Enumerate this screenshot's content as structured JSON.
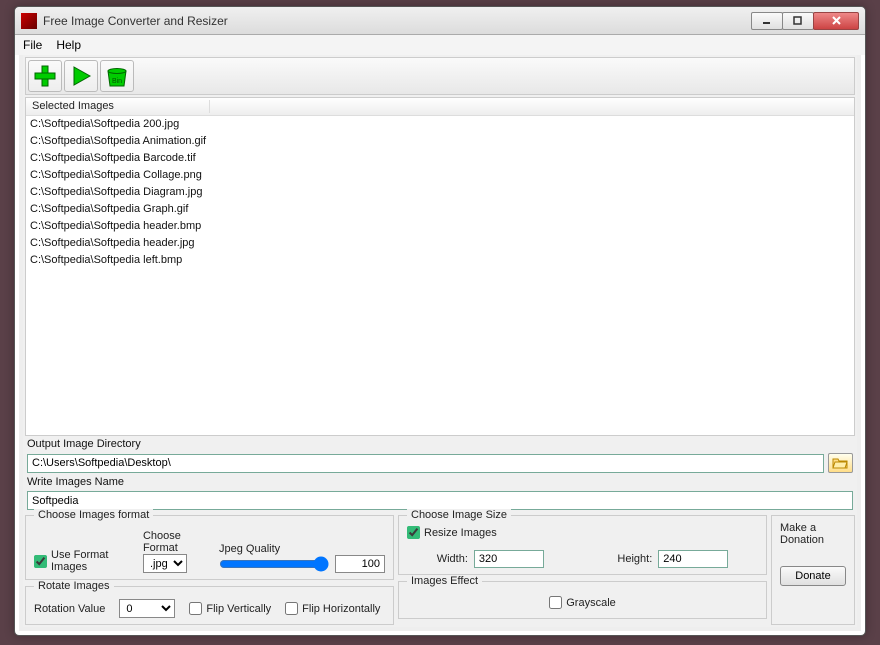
{
  "window": {
    "title": "Free Image Converter and Resizer"
  },
  "menu": {
    "file": "File",
    "help": "Help"
  },
  "toolbar": {
    "add": "add-button",
    "run": "run-button",
    "bin": "bin-button",
    "bin_label": "Bin"
  },
  "list": {
    "header": "Selected Images",
    "rows": [
      "C:\\Softpedia\\Softpedia 200.jpg",
      "C:\\Softpedia\\Softpedia Animation.gif",
      "C:\\Softpedia\\Softpedia Barcode.tif",
      "C:\\Softpedia\\Softpedia Collage.png",
      "C:\\Softpedia\\Softpedia Diagram.jpg",
      "C:\\Softpedia\\Softpedia Graph.gif",
      "C:\\Softpedia\\Softpedia header.bmp",
      "C:\\Softpedia\\Softpedia header.jpg",
      "C:\\Softpedia\\Softpedia left.bmp"
    ]
  },
  "output": {
    "dir_label": "Output Image Directory",
    "dir_value": "C:\\Users\\Softpedia\\Desktop\\",
    "name_label": "Write Images Name",
    "name_value": "Softpedia"
  },
  "format": {
    "group_title": "Choose Images format",
    "use_format_label": "Use Format Images",
    "choose_format_label": "Choose Format",
    "format_value": ".jpg",
    "quality_label": "Jpeg Quality",
    "quality_value": "100"
  },
  "rotate": {
    "group_title": "Rotate Images",
    "rotation_label": "Rotation Value",
    "rotation_value": "0",
    "flip_v": "Flip Vertically",
    "flip_h": "Flip Horizontally"
  },
  "size": {
    "group_title": "Choose Image Size",
    "resize_label": "Resize Images",
    "width_label": "Width:",
    "width_value": "320",
    "height_label": "Height:",
    "height_value": "240"
  },
  "effect": {
    "group_title": "Images Effect",
    "grayscale": "Grayscale"
  },
  "donate": {
    "title": "Make a Donation",
    "button": "Donate"
  }
}
